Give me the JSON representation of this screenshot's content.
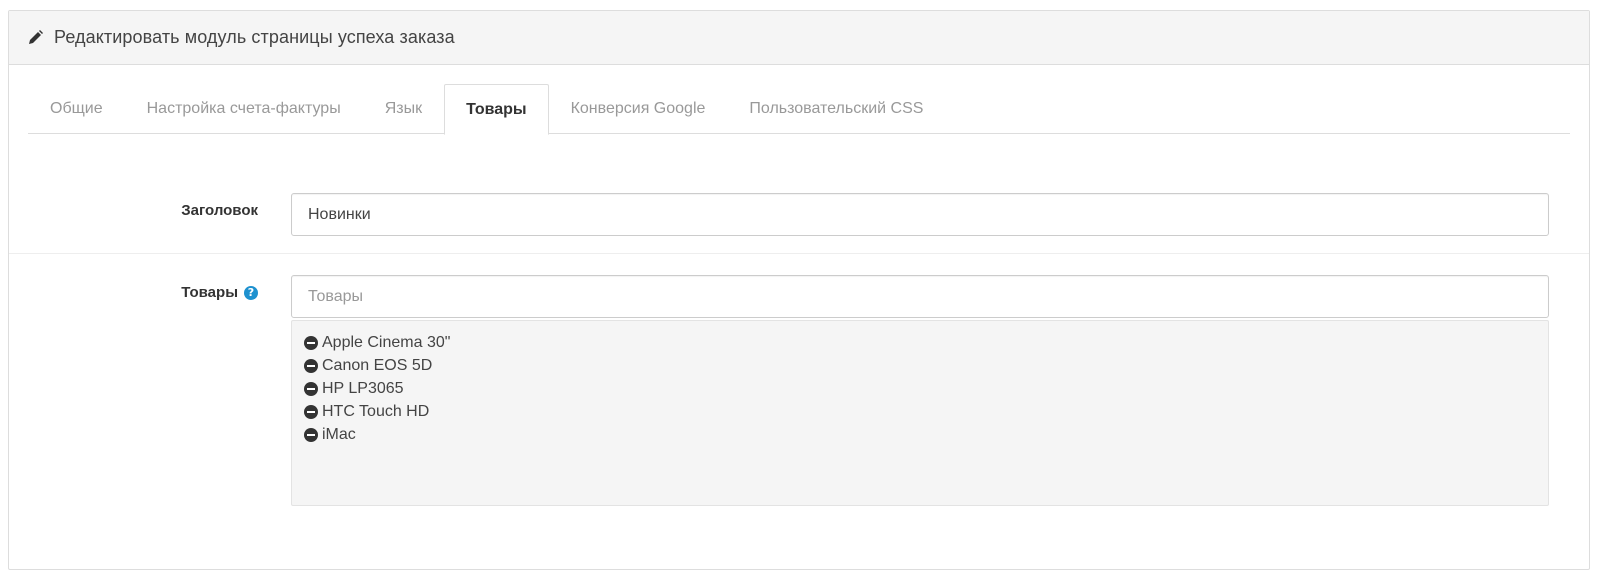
{
  "panel": {
    "title": "Редактировать модуль страницы успеха заказа",
    "title_icon": "pencil-icon"
  },
  "tabs": [
    {
      "label": "Общие",
      "active": false
    },
    {
      "label": "Настройка счета-фактуры",
      "active": false
    },
    {
      "label": "Язык",
      "active": false
    },
    {
      "label": "Товары",
      "active": true
    },
    {
      "label": "Конверсия Google",
      "active": false
    },
    {
      "label": "Пользовательский CSS",
      "active": false
    }
  ],
  "form": {
    "heading_label": "Заголовок",
    "heading_value": "Новинки",
    "products_label": "Товары",
    "products_help_icon": "question-circle-icon",
    "products_placeholder": "Товары",
    "products": [
      "Apple Cinema 30\"",
      "Canon EOS 5D",
      "HP LP3065",
      "HTC Touch HD",
      "iMac"
    ],
    "remove_icon": "minus-circle-icon"
  },
  "colors": {
    "help_icon": "#1e91cf",
    "heading_bg": "#f5f5f5",
    "well_bg": "#f5f5f5"
  }
}
